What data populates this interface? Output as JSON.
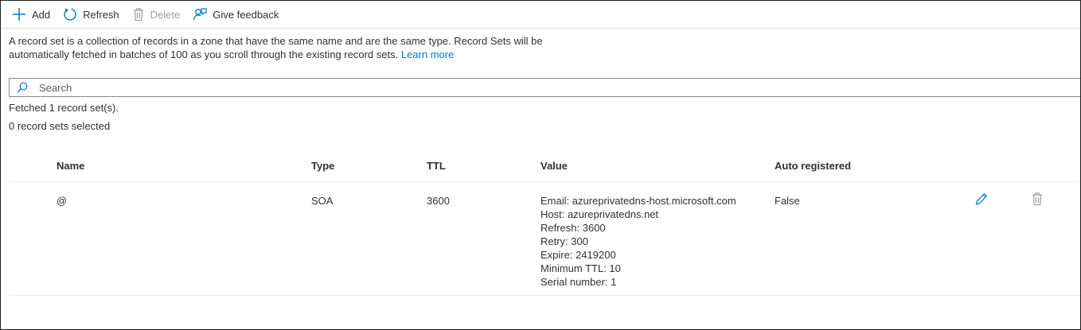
{
  "toolbar": {
    "add_label": "Add",
    "refresh_label": "Refresh",
    "delete_label": "Delete",
    "feedback_label": "Give feedback"
  },
  "description": {
    "line1": "A record set is a collection of records in a zone that have the same name and are the same type. Record Sets will be",
    "line2": "automatically fetched in batches of 100 as you scroll through the existing record sets.",
    "learn_more": "Learn more"
  },
  "search": {
    "placeholder": "Search"
  },
  "status": {
    "fetched": "Fetched 1 record set(s).",
    "selected": "0 record sets selected"
  },
  "table": {
    "columns": [
      "Name",
      "Type",
      "TTL",
      "Value",
      "Auto registered"
    ],
    "rows": [
      {
        "name": "@",
        "type": "SOA",
        "ttl": "3600",
        "value": [
          "Email: azureprivatedns-host.microsoft.com",
          "Host: azureprivatedns.net",
          "Refresh: 3600",
          "Retry: 300",
          "Expire: 2419200",
          "Minimum TTL: 10",
          "Serial number: 1"
        ],
        "auto_registered": "False"
      }
    ]
  },
  "colors": {
    "accent": "#0078d4",
    "text": "#323130",
    "disabled": "#a19f9d"
  },
  "icons": {
    "add": "plus-icon",
    "refresh": "refresh-icon",
    "delete": "trash-icon",
    "feedback": "feedback-icon",
    "search": "search-icon",
    "edit": "pencil-icon"
  }
}
